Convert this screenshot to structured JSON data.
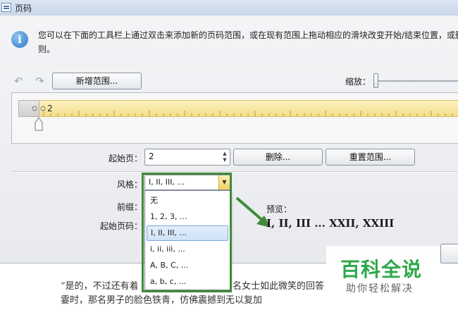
{
  "window": {
    "title": "页码"
  },
  "info": {
    "line1": "您可以在下面的工具栏上通过双击来添加新的页码范围，或在现有范围上拖动相应的滑块改变开始/结束位置，或删",
    "line2": "则。"
  },
  "toolbar": {
    "undo_icon": "undo-icon",
    "redo_icon": "redo-icon",
    "add_range": "新增范围...",
    "zoom_label": "缩放："
  },
  "ruler": {
    "range_label": "2"
  },
  "form": {
    "start_page_label": "起始页：",
    "start_page_value": "2",
    "delete": "删除...",
    "reset": "重置范围...",
    "style_label": "风格：",
    "style_value": "I, II, III, ...",
    "prefix_label": "前缀：",
    "start_number_label": "起始页码：",
    "preview_label": "预览：",
    "preview_value": "I, II, III ... XXII, XXIII"
  },
  "dropdown": {
    "options": [
      "无",
      "1, 2, 3, ...",
      "I, II, III, ...",
      "i, ii, iii, ...",
      "A, B, C, ...",
      "a, b, c, ..."
    ],
    "selected_index": 2
  },
  "document": {
    "line1_left": "“是的，不过还有着",
    "line1_right": "名女士如此微笑的回答",
    "line2": "霎时，那名男子的脸色铁青，仿佛震撼到无以复加"
  },
  "watermark": {
    "main": "百科全说",
    "sub": "助你轻松解决"
  },
  "colors": {
    "highlight_green": "#3f8a3a",
    "ruler_yellow": "#f3de8b",
    "selection_blue": "#cfe2f8"
  }
}
